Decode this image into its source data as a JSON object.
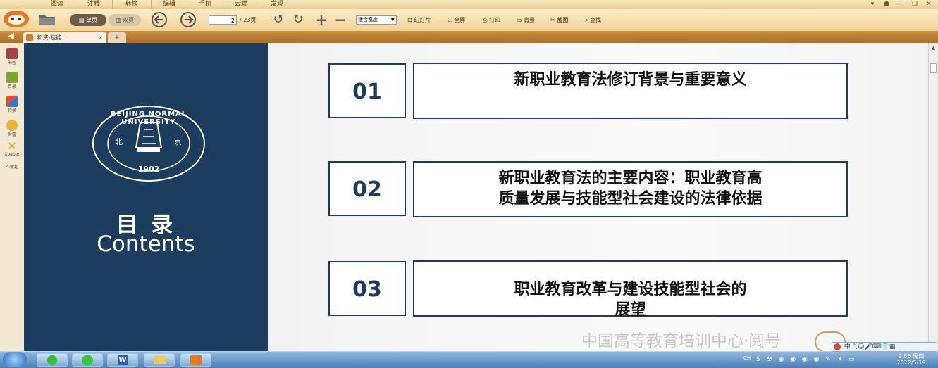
{
  "menu": {
    "tabs": [
      "阅读",
      "注释",
      "转换",
      "编辑",
      "手机",
      "云端",
      "发现"
    ]
  },
  "toolbar": {
    "single_page": "单页",
    "double_page": "双页",
    "page_current": "2",
    "page_total": "/ 23页",
    "zoom_select": "适合宽度",
    "slideshow": "幻灯片",
    "fullscreen": "全屏",
    "print": "打印",
    "background": "背景",
    "screenshot": "截图",
    "find": "查找"
  },
  "tabstrip": {
    "doc_tab": "和资-技能...",
    "close": "×",
    "new_tab": "+"
  },
  "sidebar": {
    "items": [
      {
        "label": "书签",
        "icon": "bookmark-icon"
      },
      {
        "label": "目录",
        "icon": "toc-icon"
      },
      {
        "label": "转换",
        "icon": "convert-icon"
      },
      {
        "label": "财富",
        "icon": "wealth-icon"
      },
      {
        "label": "Xpaper",
        "icon": "xpaper-icon"
      },
      {
        "label": "へ收起",
        "icon": ""
      }
    ]
  },
  "slide": {
    "logo": {
      "ring_text": "BEIJING NORMAL UNIVERSITY",
      "year": "1902",
      "side_left": "北",
      "side_right": "京"
    },
    "heading_cn": "目 录",
    "heading_en": "Contents",
    "items": [
      {
        "num": "01",
        "line1": "新职业教育法修订背景与重要意义",
        "line2": ""
      },
      {
        "num": "02",
        "line1": "新职业教育法的主要内容：职业教育高",
        "line2": "质量发展与技能型社会建设的法律依据"
      },
      {
        "num": "03",
        "line1": "职业教育改革与建设技能型社会的",
        "line2": "展望"
      }
    ],
    "watermark": "中国高等教育培训中心·阅号"
  },
  "taskbar": {
    "lang": "CH",
    "ime": "中",
    "time": "9:55 周四",
    "date": "2022/5/19"
  },
  "colors": {
    "slide_navy": "#1c3d5e",
    "toolbar_bg": "#f0d397",
    "accent_orange": "#e07a1f"
  }
}
